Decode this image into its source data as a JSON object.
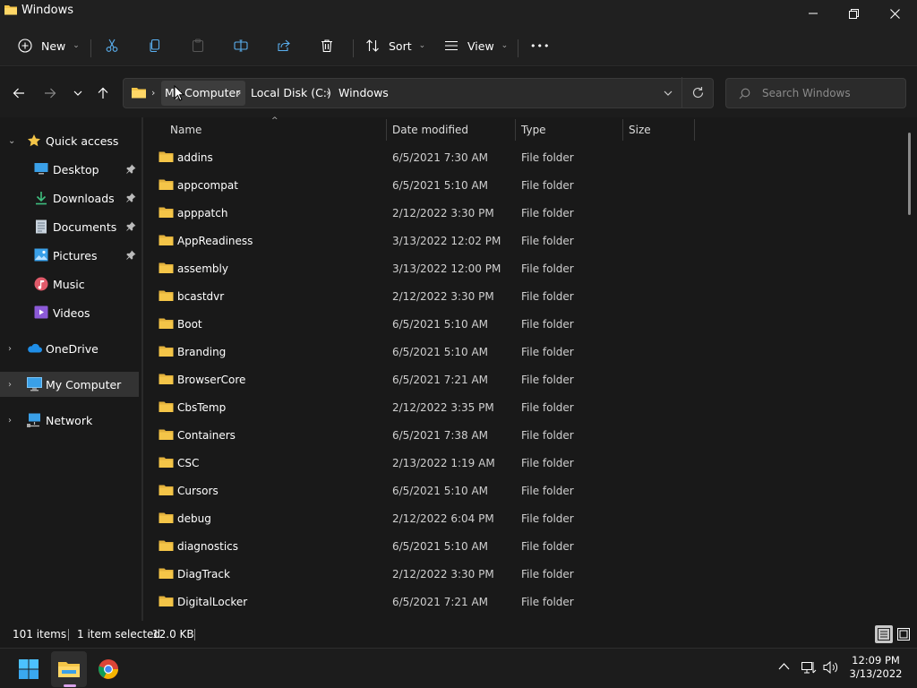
{
  "window": {
    "title": "Windows"
  },
  "toolbar": {
    "new_label": "New",
    "sort_label": "Sort",
    "view_label": "View",
    "more_label": "•••"
  },
  "address": {
    "segments": [
      "My Computer",
      "Local Disk (C:)",
      "Windows"
    ]
  },
  "search": {
    "placeholder": "Search Windows"
  },
  "nav": {
    "quick_access": "Quick access",
    "quick_items": [
      {
        "label": "Desktop",
        "icon": "desktop-icon",
        "pinned": true
      },
      {
        "label": "Downloads",
        "icon": "download-icon",
        "pinned": true
      },
      {
        "label": "Documents",
        "icon": "document-icon",
        "pinned": true
      },
      {
        "label": "Pictures",
        "icon": "pictures-icon",
        "pinned": true
      },
      {
        "label": "Music",
        "icon": "music-icon",
        "pinned": false
      },
      {
        "label": "Videos",
        "icon": "videos-icon",
        "pinned": false
      }
    ],
    "onedrive": "OneDrive",
    "my_computer": "My Computer",
    "network": "Network"
  },
  "columns": {
    "name": "Name",
    "date": "Date modified",
    "type": "Type",
    "size": "Size"
  },
  "files": [
    {
      "name": "addins",
      "date": "6/5/2021 7:30 AM",
      "type": "File folder"
    },
    {
      "name": "appcompat",
      "date": "6/5/2021 5:10 AM",
      "type": "File folder"
    },
    {
      "name": "apppatch",
      "date": "2/12/2022 3:30 PM",
      "type": "File folder"
    },
    {
      "name": "AppReadiness",
      "date": "3/13/2022 12:02 PM",
      "type": "File folder"
    },
    {
      "name": "assembly",
      "date": "3/13/2022 12:00 PM",
      "type": "File folder"
    },
    {
      "name": "bcastdvr",
      "date": "2/12/2022 3:30 PM",
      "type": "File folder"
    },
    {
      "name": "Boot",
      "date": "6/5/2021 5:10 AM",
      "type": "File folder"
    },
    {
      "name": "Branding",
      "date": "6/5/2021 5:10 AM",
      "type": "File folder"
    },
    {
      "name": "BrowserCore",
      "date": "6/5/2021 7:21 AM",
      "type": "File folder"
    },
    {
      "name": "CbsTemp",
      "date": "2/12/2022 3:35 PM",
      "type": "File folder"
    },
    {
      "name": "Containers",
      "date": "6/5/2021 7:38 AM",
      "type": "File folder"
    },
    {
      "name": "CSC",
      "date": "2/13/2022 1:19 AM",
      "type": "File folder"
    },
    {
      "name": "Cursors",
      "date": "6/5/2021 5:10 AM",
      "type": "File folder"
    },
    {
      "name": "debug",
      "date": "2/12/2022 6:04 PM",
      "type": "File folder"
    },
    {
      "name": "diagnostics",
      "date": "6/5/2021 5:10 AM",
      "type": "File folder"
    },
    {
      "name": "DiagTrack",
      "date": "2/12/2022 3:30 PM",
      "type": "File folder"
    },
    {
      "name": "DigitalLocker",
      "date": "6/5/2021 7:21 AM",
      "type": "File folder"
    }
  ],
  "status": {
    "items": "101 items",
    "selected": "1 item selected",
    "size": "12.0 KB"
  },
  "clock": {
    "time": "12:09 PM",
    "date": "3/13/2022"
  },
  "colors": {
    "folder": "#f4c548",
    "accent": "#4cc2ff",
    "background": "#191919"
  }
}
